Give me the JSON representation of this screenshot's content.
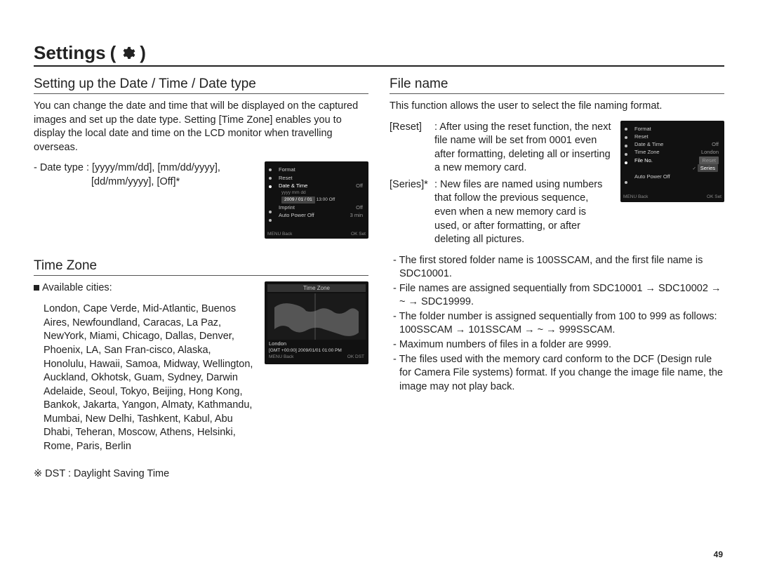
{
  "title": "Settings",
  "left": {
    "sec1_title": "Setting up the Date / Time / Date type",
    "sec1_para": "You can change the date and time that will be displayed on the captured images and set up the date type. Setting [Time Zone] enables you to display the local date and time on the LCD monitor when travelling overseas.",
    "datetype_l1": "- Date type : [yyyy/mm/dd], [mm/dd/yyyy],",
    "datetype_l2": "[dd/mm/yyyy], [Off]*",
    "menu": {
      "i0": "Format",
      "i1": "Reset",
      "i2": "Date & Time",
      "i2v": "Off",
      "i3": "yyyy  mm  dd",
      "i4a": "2009 / 01 / 01",
      "i4b": "13:00",
      "i4c": "Off",
      "i5": "Imprint",
      "i5v": "Off",
      "i6": "Auto Power Off",
      "i6v": "3 min",
      "fL": "MENU  Back",
      "fR": "OK  Set"
    },
    "sec2_title": "Time Zone",
    "avail_label": "Available cities:",
    "cities": "London, Cape Verde, Mid-Atlantic, Buenos Aires, Newfoundland, Caracas, La Paz, NewYork, Miami, Chicago, Dallas, Denver, Phoenix, LA, San Fran-cisco, Alaska, Honolulu, Hawaii, Samoa, Midway, Wellington, Auckland, Okhotsk, Guam, Sydney, Darwin Adelaide, Seoul, Tokyo, Beijing, Hong Kong, Bankok, Jakarta, Yangon, Almaty, Kathmandu, Mumbai, New Delhi, Tashkent, Kabul, Abu Dhabi, Teheran, Moscow, Athens, Helsinki, Rome, Paris, Berlin",
    "tz": {
      "hdr": "Time Zone",
      "city": "London",
      "gmt": "[GMT +00:00]   2009/01/01   01:00 PM",
      "fL": "MENU  Back",
      "fR": "OK  DST"
    },
    "dst": "※ DST : Daylight Saving Time"
  },
  "right": {
    "sec_title": "File name",
    "intro": "This function allows the user to select the file naming format.",
    "reset_k": "[Reset]",
    "reset_v": ": After using the reset function, the next file name will be set from 0001 even after formatting, deleting all or inserting a new memory card.",
    "series_k": "[Series]*",
    "series_v": ": New files are named using numbers that follow the previous sequence, even when a new memory card is used, or after formatting, or after deleting all pictures.",
    "menu": {
      "i0": "Format",
      "i1": "Reset",
      "i2": "Date & Time",
      "i2v": "Off",
      "i3": "Time Zone",
      "i3v": "London",
      "i4": "File No.",
      "i4a": "Reset",
      "i4b": "Series",
      "i5": "Auto Power Off",
      "fL": "MENU  Back",
      "fR": "OK  Set"
    },
    "b1": "- The first stored folder name is 100SSCAM, and the first file name is SDC10001.",
    "b2": "- File names are assigned sequentially from SDC10001 → SDC10002 → ~ → SDC19999.",
    "b3": "- The folder number is assigned sequentially from 100 to 999 as follows: 100SSCAM → 101SSCAM → ~ → 999SSCAM.",
    "b4": "- Maximum numbers of files in a folder are 9999.",
    "b5": "- The files used with the memory card conform to the DCF (Design rule for Camera File systems) format. If you change the image file name, the image may not play back."
  },
  "page_number": "49"
}
